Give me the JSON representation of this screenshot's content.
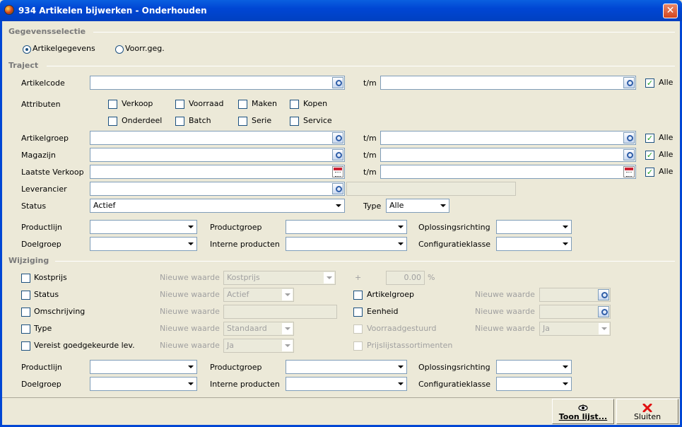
{
  "window": {
    "title": "934 Artikelen bijwerken - Onderhouden",
    "close": "✕"
  },
  "sections": {
    "selectie": "Gegevensselectie",
    "traject": "Traject",
    "wijziging": "Wijziging"
  },
  "selectie": {
    "artikelgegevens": "Artikelgegevens",
    "voorraad": "Voorr.geg.",
    "selected": "Artikelgegevens"
  },
  "traject": {
    "tm": "t/m",
    "alle": "Alle",
    "artikelcode": "Artikelcode",
    "attributen": "Attributen",
    "attributes": [
      "Verkoop",
      "Voorraad",
      "Maken",
      "Kopen",
      "Onderdeel",
      "Batch",
      "Serie",
      "Service"
    ],
    "artikelgroep": "Artikelgroep",
    "magazijn": "Magazijn",
    "laatste_verkoop": "Laatste Verkoop",
    "leverancier": "Leverancier",
    "status": "Status",
    "status_value": "Actief",
    "type": "Type",
    "type_value": "Alle",
    "productlijn": "Productlijn",
    "productgroep": "Productgroep",
    "oplossingsrichting": "Oplossingsrichting",
    "doelgroep": "Doelgroep",
    "interne_producten": "Interne producten",
    "configuratieklasse": "Configuratieklasse"
  },
  "wijziging": {
    "nieuwe_waarde": "Nieuwe waarde",
    "kostprijs": "Kostprijs",
    "kostprijs_value": "Kostprijs",
    "plus": "+",
    "percent_value": "0.00",
    "percent": "%",
    "status": "Status",
    "status_value": "Actief",
    "omschrijving": "Omschrijving",
    "type": "Type",
    "type_value": "Standaard",
    "vereist": "Vereist goedgekeurde lev.",
    "vereist_value": "Ja",
    "artikelgroep": "Artikelgroep",
    "eenheid": "Eenheid",
    "voorraadgestuurd": "Voorraadgestuurd",
    "voorraadgestuurd_value": "Ja",
    "prijslijst": "Prijslijstassortimenten",
    "productlijn": "Productlijn",
    "productgroep": "Productgroep",
    "oplossingsrichting": "Oplossingsrichting",
    "doelgroep": "Doelgroep",
    "interne_producten": "Interne producten",
    "configuratieklasse": "Configuratieklasse"
  },
  "buttons": {
    "toon_lijst": "Toon lijst...",
    "sluiten": "Sluiten"
  }
}
